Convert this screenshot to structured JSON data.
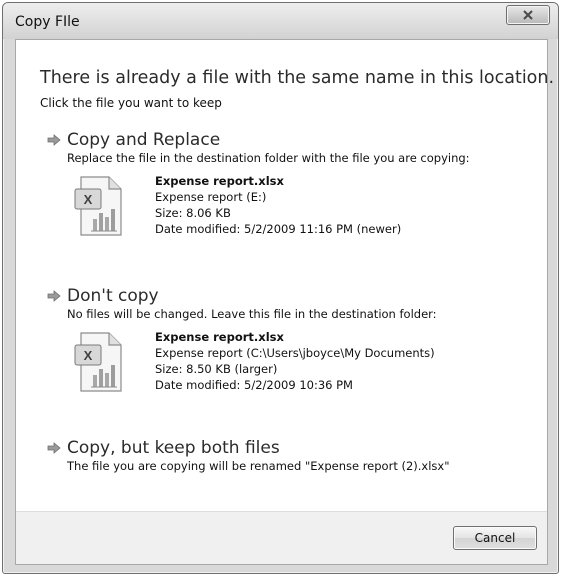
{
  "window": {
    "title": "Copy FIle"
  },
  "dialog": {
    "heading": "There is already a file with the same name in this location.",
    "subheading": "Click the file you want to keep"
  },
  "options": [
    {
      "title": "Copy and Replace",
      "description": "Replace the file in the destination folder with the file you are copying:",
      "file": {
        "name": "Expense report.xlsx",
        "location": "Expense report (E:)",
        "size": "Size: 8.06 KB",
        "modified": "Date modified: 5/2/2009 11:16 PM (newer)"
      }
    },
    {
      "title": "Don't copy",
      "description": "No files will be changed. Leave this file in the destination folder:",
      "file": {
        "name": "Expense report.xlsx",
        "location": "Expense report (C:\\Users\\jboyce\\My Documents)",
        "size": "Size: 8.50 KB (larger)",
        "modified": "Date modified: 5/2/2009 10:36 PM"
      }
    },
    {
      "title": "Copy, but keep both files",
      "description": "The file you are copying will be renamed \"Expense report (2).xlsx\""
    }
  ],
  "footer": {
    "cancel_label": "Cancel"
  },
  "icons": {
    "close": "close-icon",
    "arrow": "green-arrow-icon",
    "file": "excel-file-icon"
  },
  "colors": {
    "client_bg": "#ffffff",
    "frame": "#d9d9d9",
    "footer_bg": "#f0f0f0"
  }
}
